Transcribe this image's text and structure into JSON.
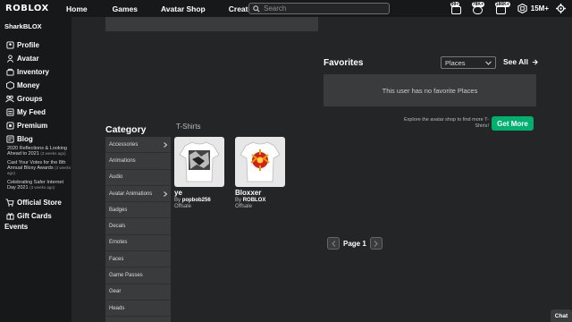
{
  "topbar": {
    "logo": "ROBLOX",
    "nav": [
      "Home",
      "Games",
      "Avatar Shop",
      "Create"
    ],
    "search_placeholder": "Search",
    "badges": [
      "99+",
      "78K+",
      "186K+"
    ],
    "robux": "15M+"
  },
  "sidebar": {
    "username": "SharkBLOX",
    "items": [
      {
        "label": "Profile",
        "icon": "profile-icon"
      },
      {
        "label": "Avatar",
        "icon": "avatar-icon"
      },
      {
        "label": "Inventory",
        "icon": "inventory-icon"
      },
      {
        "label": "Money",
        "icon": "money-icon"
      },
      {
        "label": "Groups",
        "icon": "groups-icon"
      },
      {
        "label": "My Feed",
        "icon": "feed-icon"
      },
      {
        "label": "Premium",
        "icon": "premium-icon"
      },
      {
        "label": "Blog",
        "icon": "blog-icon"
      }
    ],
    "blog_posts": [
      {
        "title": "2020 Reflections & Looking Ahead to 2021",
        "ago": "(3 weeks ago)"
      },
      {
        "title": "Cast Your Votes for the 8th Annual Bloxy Awards",
        "ago": "(3 weeks ago)"
      },
      {
        "title": "Celebrating Safer Internet Day 2021",
        "ago": "(3 weeks ago)"
      }
    ],
    "store": "Official Store",
    "giftcards": "Gift Cards",
    "events": "Events"
  },
  "favorites": {
    "title": "Favorites",
    "dropdown": "Places",
    "see_all": "See All",
    "empty": "This user has no favorite Places"
  },
  "explore": {
    "text": "Explore the avatar shop to find more T-Shirts!",
    "button": "Get More"
  },
  "category": {
    "title": "Category",
    "section": "T-Shirts",
    "items": [
      "Accessories",
      "Animations",
      "Audio",
      "Avatar Animations",
      "Badges",
      "Decals",
      "Emotes",
      "Faces",
      "Game Passes",
      "Gear",
      "Heads"
    ]
  },
  "items": [
    {
      "name": "ye",
      "by_prefix": "By",
      "creator": "popbob256",
      "status": "Offsale"
    },
    {
      "name": "Bloxxer",
      "by_prefix": "By",
      "creator": "ROBLOX",
      "status": "Offsale"
    }
  ],
  "pager": {
    "label": "Page 1"
  },
  "chat": "Chat"
}
